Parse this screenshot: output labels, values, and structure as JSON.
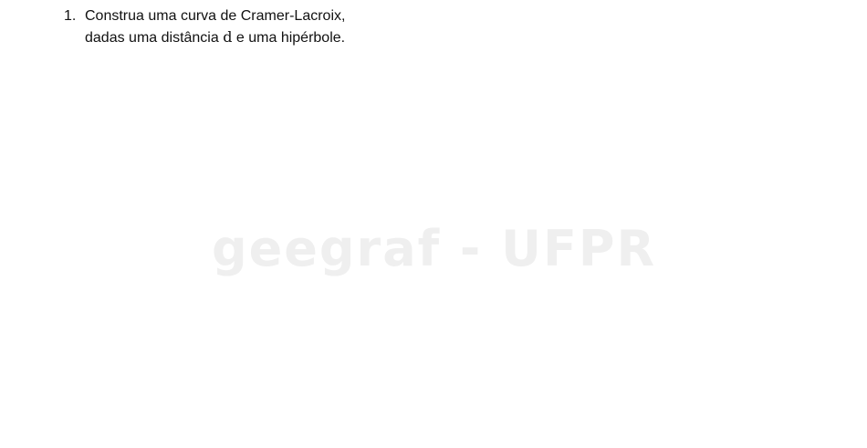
{
  "question": {
    "number": "1.",
    "line1": "Construa uma curva de Cramer-Lacroix,",
    "line2_before": "dadas uma distância ",
    "variable": "d",
    "line2_after": " e uma hipérbole."
  },
  "watermark": {
    "text": "geegraf - UFPR",
    "color": "#efefef"
  }
}
